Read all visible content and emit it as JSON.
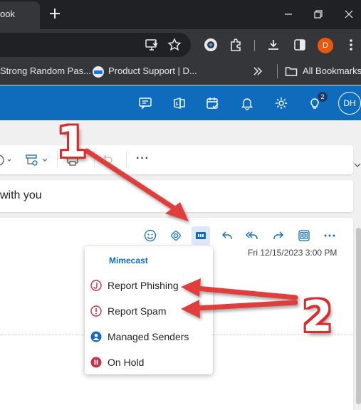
{
  "browser": {
    "tab_title": "ook",
    "profile_initial": "D",
    "colors": {
      "tabstrip": "#202124",
      "toolbar": "#35363a",
      "profile": "#e8590c"
    }
  },
  "bookmarks": {
    "items": [
      {
        "label": "Strong Random Pas...",
        "icon": "none"
      },
      {
        "label": "Product Support | D...",
        "icon": "dell-logo-icon"
      }
    ],
    "overflow_icon": "chevron-double-right-icon",
    "all_bookmarks_label": "All Bookmarks"
  },
  "outlook_header": {
    "badge_count": "2",
    "avatar_initials": "DH",
    "icons": [
      "teams-chat-icon",
      "office-apps-icon",
      "calendar-check-icon",
      "bell-icon",
      "gear-icon",
      "lightbulb-icon"
    ],
    "colors": {
      "brand": "#0f6cbd"
    }
  },
  "ribbon": {
    "more_label": "···"
  },
  "message": {
    "subject": "with you",
    "date": "Fri 12/15/2023 3:00 PM",
    "action_icons": [
      "emoji-icon",
      "loop-icon",
      "mimecast-icon",
      "reply-icon",
      "reply-all-icon",
      "forward-icon",
      "apps-grid-icon",
      "more-icon"
    ]
  },
  "mimecast_menu": {
    "title": "Mimecast",
    "items": [
      {
        "label": "Report Phishing",
        "icon": "phishing-hook-icon",
        "color": "#c4314b"
      },
      {
        "label": "Report Spam",
        "icon": "alert-circle-icon",
        "color": "#c4314b"
      },
      {
        "label": "Managed Senders",
        "icon": "user-circle-icon",
        "color": "#0f6cbd"
      },
      {
        "label": "On Hold",
        "icon": "pause-circle-icon",
        "color": "#c4314b"
      }
    ]
  },
  "annotations": {
    "step1": "1",
    "step2": "2",
    "color": "#e03c3c"
  }
}
